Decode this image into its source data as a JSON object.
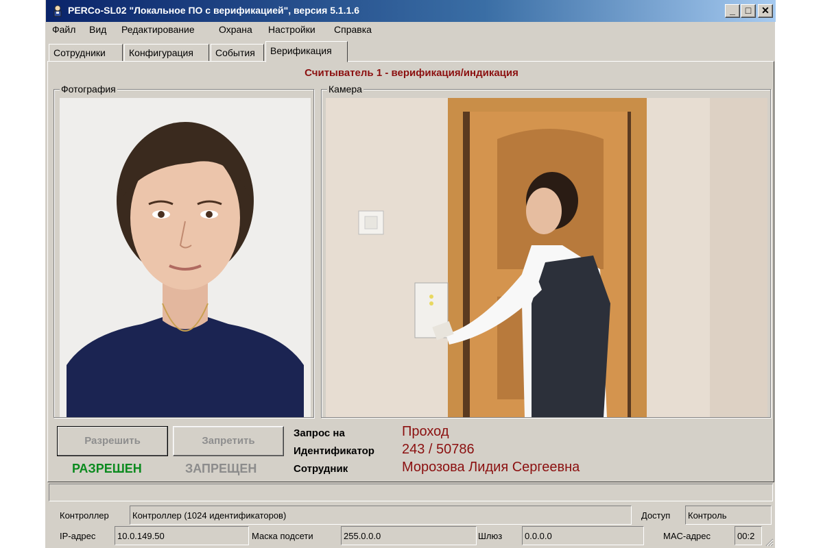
{
  "window": {
    "title": "PERCo-SL02 \"Локальное ПО с верификацией\", версия 5.1.1.6",
    "minimize_glyph": "_",
    "maximize_glyph": "□",
    "close_glyph": "✕"
  },
  "menu": [
    "Файл",
    "Вид",
    "Редактирование",
    "Охрана",
    "Настройки",
    "Справка"
  ],
  "tabs": [
    "Сотрудники",
    "Конфигурация",
    "События",
    "Верификация"
  ],
  "active_tab": "Верификация",
  "reader_title": "Считыватель 1 - верификация/индикация",
  "photo_group_label": "Фотография",
  "camera_group_label": "Камера",
  "buttons": {
    "allow": "Разрешить",
    "deny": "Запретить"
  },
  "status": {
    "allowed": "РАЗРЕШЕН",
    "denied": "ЗАПРЕЩЕН",
    "allowed_color": "#0a8a1e",
    "denied_color": "#8c8c8c"
  },
  "request": {
    "request_label": "Запрос на",
    "request_value": "Проход",
    "id_label": "Идентификатор",
    "id_value": "243 / 50786",
    "employee_label": "Сотрудник",
    "employee_value": "Морозова Лидия Сергеевна",
    "value_color": "#8b1010"
  },
  "status_bar": {
    "controller_label": "Контроллер",
    "controller_value": "Контроллер (1024 идентификаторов)",
    "access_label": "Доступ",
    "access_value": "Контроль",
    "ip_label": "IP-адрес",
    "ip_value": "10.0.149.50",
    "mask_label": "Маска подсети",
    "mask_value": "255.0.0.0",
    "gateway_label": "Шлюз",
    "gateway_value": "0.0.0.0",
    "mac_label": "MAC-адрес",
    "mac_value": "00:2"
  },
  "icons": [
    "app-person-icon",
    "minimize-icon",
    "maximize-icon",
    "close-icon",
    "resize-grip-icon"
  ]
}
